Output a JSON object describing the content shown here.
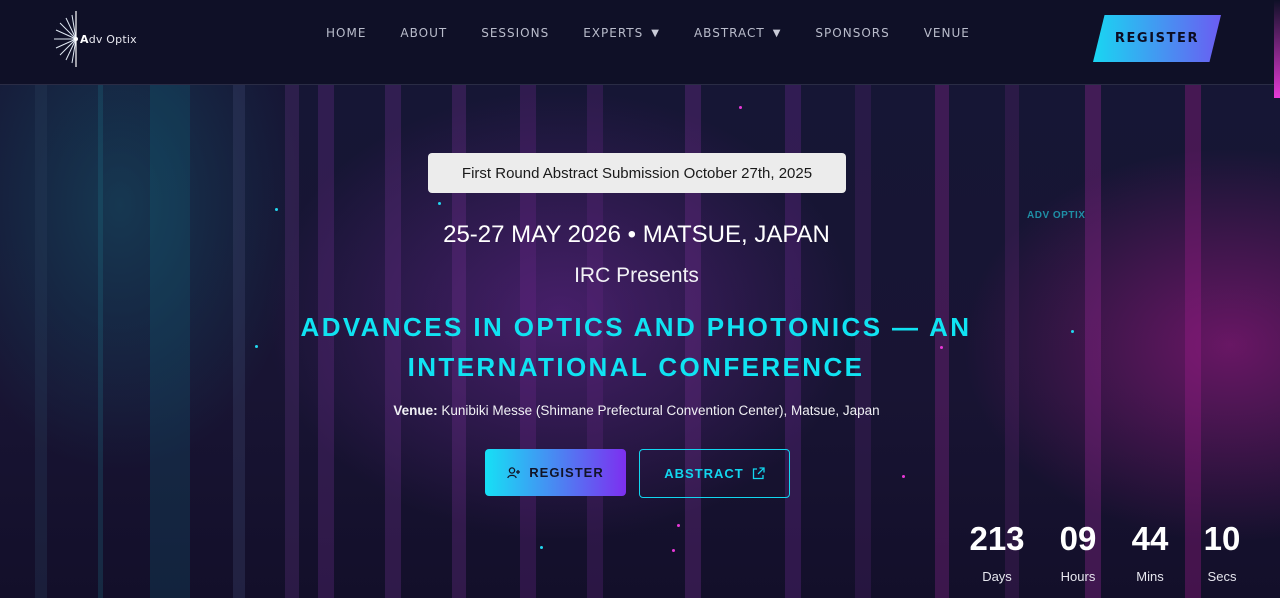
{
  "header": {
    "logo_text_a": "A",
    "logo_text_rest": "dv Optix",
    "nav": [
      {
        "label": "HOME",
        "caret": ""
      },
      {
        "label": "ABOUT",
        "caret": ""
      },
      {
        "label": "SESSIONS",
        "caret": ""
      },
      {
        "label": "EXPERTS",
        "caret": "▼"
      },
      {
        "label": "ABSTRACT",
        "caret": "▼"
      },
      {
        "label": "SPONSORS",
        "caret": ""
      },
      {
        "label": "VENUE",
        "caret": ""
      }
    ],
    "register_label": "REGISTER"
  },
  "hero": {
    "notice": "First Round Abstract Submission October 27th, 2025",
    "dateline": "25-27 MAY 2026 • MATSUE, JAPAN",
    "presents": "IRC Presents",
    "title_line1": "ADVANCES IN OPTICS AND PHOTONICS — AN",
    "title_line2": "INTERNATIONAL CONFERENCE",
    "venue_label": "Venue:",
    "venue_text": " Kunibiki Messe (Shimane Prefectural Convention Center), Matsue, Japan",
    "register_label": "REGISTER",
    "abstract_label": "ABSTRACT",
    "watermark": "ADV OPTIX"
  },
  "countdown": {
    "days": "213",
    "days_label": "Days",
    "hours": "09",
    "hours_label": "Hours",
    "mins": "44",
    "mins_label": "Mins",
    "secs": "10",
    "secs_label": "Secs"
  },
  "colors": {
    "accent_cyan": "#10e3f2",
    "accent_purple": "#7d2ff0",
    "header_bg": "#0f1027"
  }
}
